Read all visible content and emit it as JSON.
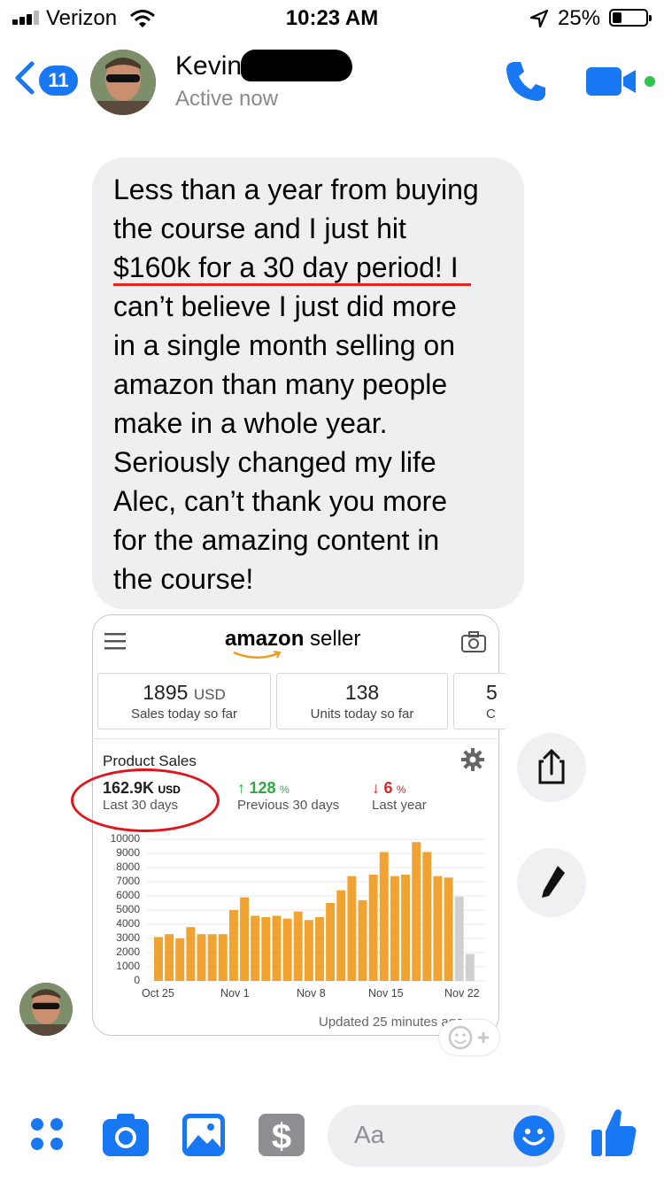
{
  "status_bar": {
    "carrier": "Verizon",
    "time": "10:23 AM",
    "battery_percent": "25%"
  },
  "header": {
    "back_badge": "11",
    "contact_name": "Kevin",
    "status": "Active now"
  },
  "message": {
    "lines": [
      "Less than a year from buying",
      "the course and I just hit",
      "$160k for a 30 day period! I",
      "can’t believe I just did more",
      "in a single month selling on",
      "amazon than many people",
      "make in a whole year.",
      "Seriously changed my life",
      "Alec, can’t thank you more",
      "for the amazing content in",
      "the course!"
    ]
  },
  "amazon_card": {
    "logo_left": "amazon",
    "logo_right": "seller",
    "tiles": [
      {
        "value": "1895",
        "unit": "USD",
        "label": "Sales today so far"
      },
      {
        "value": "138",
        "unit": "",
        "label": "Units today so far"
      },
      {
        "value": "5",
        "unit": "",
        "label": "C"
      }
    ],
    "product_sales_title": "Product Sales",
    "metrics": [
      {
        "value": "162.9K",
        "unit": "USD",
        "label": "Last 30 days",
        "arrow": ""
      },
      {
        "value": "128",
        "unit": "%",
        "label": "Previous 30 days",
        "arrow": "↑"
      },
      {
        "value": "6",
        "unit": "%",
        "label": "Last year",
        "arrow": "↓"
      }
    ],
    "updated": "Updated 25 minutes ago"
  },
  "chart_data": {
    "type": "bar",
    "ylim": [
      0,
      10000
    ],
    "yticks": [
      "10000",
      "9000",
      "8000",
      "7000",
      "6000",
      "5000",
      "4000",
      "3000",
      "2000",
      "1000",
      "0"
    ],
    "xticks": [
      "Oct 25",
      "Nov 1",
      "Nov 8",
      "Nov 15",
      "Nov 22"
    ],
    "bar_color": "#f0a330",
    "pending_color": "#d0d0d0",
    "series": [
      {
        "name": "",
        "values": [
          3100,
          3300,
          3000,
          3800,
          3300,
          3300,
          3300,
          5000,
          5900,
          4600,
          4500,
          4600,
          4400,
          4900,
          4300,
          4500,
          5500,
          6400,
          7400,
          5700,
          7500,
          9100,
          7400,
          7500,
          9800,
          9100,
          7400,
          7300,
          5950,
          1900
        ]
      }
    ],
    "pending_from_index": 28,
    "grid": true
  },
  "composer": {
    "placeholder": "Aa"
  },
  "icons": {
    "accent": "#1877f2"
  }
}
